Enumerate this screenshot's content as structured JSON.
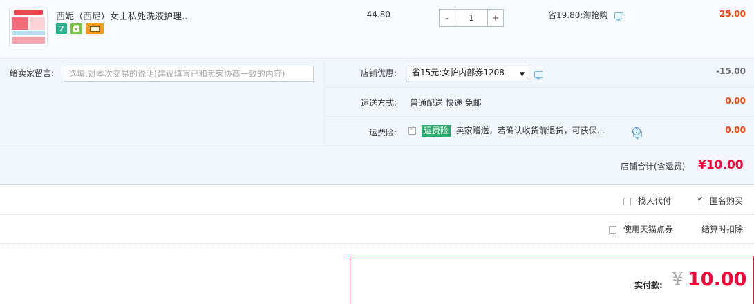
{
  "product": {
    "title": "西妮（西尼）女士私处洗液护理...",
    "badges": [
      "7",
      "shop",
      "card"
    ],
    "badge_seven": "7",
    "unit_price": "44.80",
    "quantity": "1",
    "qty_minus": "-",
    "qty_plus": "+",
    "promotion": "省19.80:淘抢购",
    "subtotal": "25.00"
  },
  "message": {
    "label": "给卖家留言:",
    "placeholder": "选填:对本次交易的说明(建议填写已和卖家协商一致的内容)"
  },
  "shop_discount": {
    "label": "店铺优惠:",
    "selected": "省15元:女护内部券1208",
    "amount": "-15.00"
  },
  "delivery": {
    "label": "运送方式:",
    "value": "普通配送 快递 免邮",
    "amount": "0.00"
  },
  "insurance": {
    "label": "运费险:",
    "tag": "运费险",
    "text": "卖家赠送，若确认收货前退货，可获保...",
    "help": "?",
    "amount": "0.00"
  },
  "shop_total": {
    "label": "店铺合计(含运费)",
    "value": "¥10.00"
  },
  "services": {
    "proxy_pay": "找人代付",
    "anonymous": "匿名购买",
    "tmall_points": "使用天猫点券",
    "deduct_note": "结算时扣除"
  },
  "payment": {
    "label": "实付款:",
    "currency": "¥",
    "value": "10.00"
  },
  "colors": {
    "accent_red": "#ff0036",
    "amount_orange": "#ff4000",
    "insurance_green": "#2dab6e",
    "row_bg": "#f2f7fd"
  }
}
